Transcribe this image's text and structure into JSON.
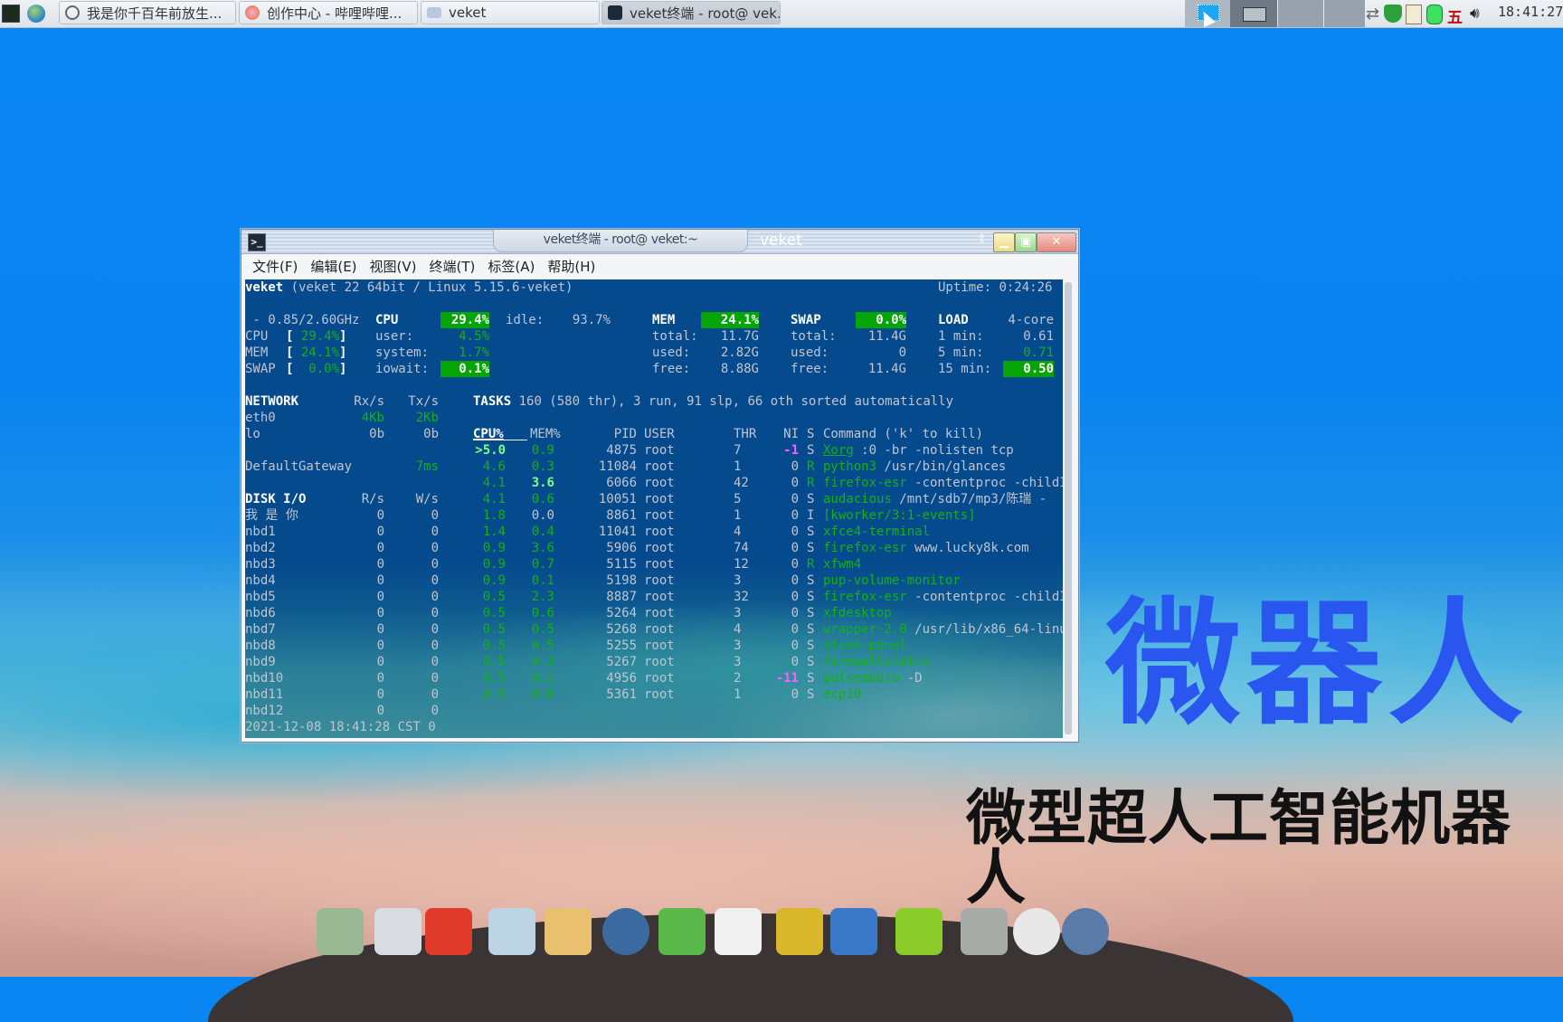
{
  "taskbar": {
    "launchers": [
      {
        "icon": "terminal-icon"
      },
      {
        "icon": "globe-icon"
      }
    ],
    "tasks": [
      {
        "icon": "app-icon",
        "label": "我是你千百年前放生..."
      },
      {
        "icon": "firefox-icon",
        "label": "创作中心 - 哔哩哔哩..."
      },
      {
        "icon": "folder-icon",
        "label": "veket"
      },
      {
        "icon": "terminal-icon",
        "label": "veket终端 - root@ vek…",
        "active": true
      }
    ],
    "tray": {
      "input_method": "五",
      "clock": "18:41:27"
    }
  },
  "window": {
    "tab_title": "veket终端 - root@ veket:~",
    "title": "veket",
    "menu": [
      "文件(F)",
      "编辑(E)",
      "视图(V)",
      "终端(T)",
      "标签(A)",
      "帮助(H)"
    ]
  },
  "glances": {
    "host": "veket",
    "system": "(veket 22 64bit / Linux 5.15.6-veket)",
    "uptime_label": "Uptime:",
    "uptime": "0:24:26",
    "cpu_freq": " - 0.85/2.60GHz",
    "quicklook": [
      {
        "label": "CPU",
        "value": "29.4%"
      },
      {
        "label": "MEM",
        "value": "24.1%"
      },
      {
        "label": "SWAP",
        "value": "0.0%"
      }
    ],
    "cpu": {
      "title": "CPU",
      "percent": "29.4%",
      "idle_label": "idle:",
      "idle": "93.7%",
      "user_label": "user:",
      "user": "4.5%",
      "system_label": "system:",
      "system": "1.7%",
      "iowait_label": "iowait:",
      "iowait": "0.1%"
    },
    "mem": {
      "title": "MEM",
      "percent": "24.1%",
      "total_label": "total:",
      "total": "11.7G",
      "used_label": "used:",
      "used": "2.82G",
      "free_label": "free:",
      "free": "8.88G"
    },
    "swap": {
      "title": "SWAP",
      "percent": "0.0%",
      "total_label": "total:",
      "total": "11.4G",
      "used_label": "used:",
      "used": "0",
      "free_label": "free:",
      "free": "11.4G"
    },
    "load": {
      "title": "LOAD",
      "cores": "4-core",
      "min1_label": "1 min:",
      "min1": "0.61",
      "min5_label": "5 min:",
      "min5": "0.71",
      "min15_label": "15 min:",
      "min15": "0.50"
    },
    "network": {
      "title": "NETWORK",
      "rx_header": "Rx/s",
      "tx_header": "Tx/s",
      "rows": [
        {
          "iface": "eth0",
          "rx": "4Kb",
          "tx": "2Kb"
        },
        {
          "iface": "lo",
          "rx": "0b",
          "tx": "0b"
        }
      ],
      "gateway_label": "DefaultGateway",
      "gateway": "7ms"
    },
    "disk": {
      "title": "DISK I/O",
      "r_header": "R/s",
      "w_header": "W/s",
      "rows": [
        {
          "name": "我 是 你",
          "r": "0",
          "w": "0"
        },
        {
          "name": "nbd1",
          "r": "0",
          "w": "0"
        },
        {
          "name": "nbd2",
          "r": "0",
          "w": "0"
        },
        {
          "name": "nbd3",
          "r": "0",
          "w": "0"
        },
        {
          "name": "nbd4",
          "r": "0",
          "w": "0"
        },
        {
          "name": "nbd5",
          "r": "0",
          "w": "0"
        },
        {
          "name": "nbd6",
          "r": "0",
          "w": "0"
        },
        {
          "name": "nbd7",
          "r": "0",
          "w": "0"
        },
        {
          "name": "nbd8",
          "r": "0",
          "w": "0"
        },
        {
          "name": "nbd9",
          "r": "0",
          "w": "0"
        },
        {
          "name": "nbd10",
          "r": "0",
          "w": "0"
        },
        {
          "name": "nbd11",
          "r": "0",
          "w": "0"
        },
        {
          "name": "nbd12",
          "r": "0",
          "w": "0"
        }
      ]
    },
    "footer": "2021-12-08 18:41:28 CST 0",
    "tasks": {
      "title": "TASKS",
      "summary": "160 (580 thr), 3 run, 91 slp, 66 oth sorted automatically"
    },
    "process_headers": {
      "cpu": "CPU%",
      "mem": "MEM%",
      "pid": "PID",
      "user": "USER",
      "thr": "THR",
      "ni": "NI",
      "s": "S",
      "cmd": "Command ('k' to kill)"
    },
    "processes": [
      {
        "cpu": ">5.0",
        "mem": "0.9",
        "pid": "4875",
        "user": "root",
        "thr": "7",
        "ni": "-1",
        "s": "S",
        "cmd": "Xorg",
        "args": " :0 -br -nolisten tcp"
      },
      {
        "cpu": "4.6",
        "mem": "0.3",
        "pid": "11084",
        "user": "root",
        "thr": "1",
        "ni": "0",
        "s": "R",
        "cmd": "python3",
        "args": " /usr/bin/glances"
      },
      {
        "cpu": "4.1",
        "mem": "3.6",
        "pid": "6066",
        "user": "root",
        "thr": "42",
        "ni": "0",
        "s": "R",
        "cmd": "firefox-esr",
        "args": " -contentproc -childI"
      },
      {
        "cpu": "4.1",
        "mem": "0.6",
        "pid": "10051",
        "user": "root",
        "thr": "5",
        "ni": "0",
        "s": "S",
        "cmd": "audacious",
        "args": " /mnt/sdb7/mp3/陈瑞 -"
      },
      {
        "cpu": "1.8",
        "mem": "0.0",
        "pid": "8861",
        "user": "root",
        "thr": "1",
        "ni": "0",
        "s": "I",
        "cmd": "[kworker/3:1-events]",
        "args": ""
      },
      {
        "cpu": "1.4",
        "mem": "0.4",
        "pid": "11041",
        "user": "root",
        "thr": "4",
        "ni": "0",
        "s": "S",
        "cmd": "xfce4-terminal",
        "args": ""
      },
      {
        "cpu": "0.9",
        "mem": "3.6",
        "pid": "5906",
        "user": "root",
        "thr": "74",
        "ni": "0",
        "s": "S",
        "cmd": "firefox-esr",
        "args": " www.lucky8k.com"
      },
      {
        "cpu": "0.9",
        "mem": "0.7",
        "pid": "5115",
        "user": "root",
        "thr": "12",
        "ni": "0",
        "s": "R",
        "cmd": "xfwm4",
        "args": ""
      },
      {
        "cpu": "0.9",
        "mem": "0.1",
        "pid": "5198",
        "user": "root",
        "thr": "3",
        "ni": "0",
        "s": "S",
        "cmd": "pup-volume-monitor",
        "args": ""
      },
      {
        "cpu": "0.5",
        "mem": "2.3",
        "pid": "8887",
        "user": "root",
        "thr": "32",
        "ni": "0",
        "s": "S",
        "cmd": "firefox-esr",
        "args": " -contentproc -childI"
      },
      {
        "cpu": "0.5",
        "mem": "0.6",
        "pid": "5264",
        "user": "root",
        "thr": "3",
        "ni": "0",
        "s": "S",
        "cmd": "xfdesktop",
        "args": ""
      },
      {
        "cpu": "0.5",
        "mem": "0.5",
        "pid": "5268",
        "user": "root",
        "thr": "4",
        "ni": "0",
        "s": "S",
        "cmd": "wrapper-2.0",
        "args": " /usr/lib/x86_64-linu"
      },
      {
        "cpu": "0.5",
        "mem": "0.5",
        "pid": "5255",
        "user": "root",
        "thr": "3",
        "ni": "0",
        "s": "S",
        "cmd": "xfce4-panel",
        "args": ""
      },
      {
        "cpu": "0.5",
        "mem": "0.3",
        "pid": "5267",
        "user": "root",
        "thr": "3",
        "ni": "0",
        "s": "S",
        "cmd": "firewallstatus",
        "args": ""
      },
      {
        "cpu": "0.5",
        "mem": "0.1",
        "pid": "4956",
        "user": "root",
        "thr": "2",
        "ni": "-11",
        "s": "S",
        "cmd": "pulseaudio",
        "args": " -D"
      },
      {
        "cpu": "0.5",
        "mem": "0.0",
        "pid": "5361",
        "user": "root",
        "thr": "1",
        "ni": "0",
        "s": "S",
        "cmd": "ecp10",
        "args": ""
      }
    ]
  },
  "desktop": {
    "headline": "微器人",
    "subheadline": "微型超人工智能机器人"
  },
  "dock": {
    "items": [
      "file-manager-icon",
      "monitor-icon",
      "pet-icon",
      "text-editor-icon",
      "paint-icon",
      "media-player-icon",
      "network-user-icon",
      "penguin-icon",
      "notebook-icon",
      "chart-icon",
      "help-icon",
      "drive-icon",
      "brightness-icon",
      "globe-icon"
    ]
  },
  "colors": {
    "terminal_bg": "#064a8e",
    "highlight_green": "#06a506",
    "text_green": "#14b014",
    "headline_blue": "#2a56f0"
  }
}
